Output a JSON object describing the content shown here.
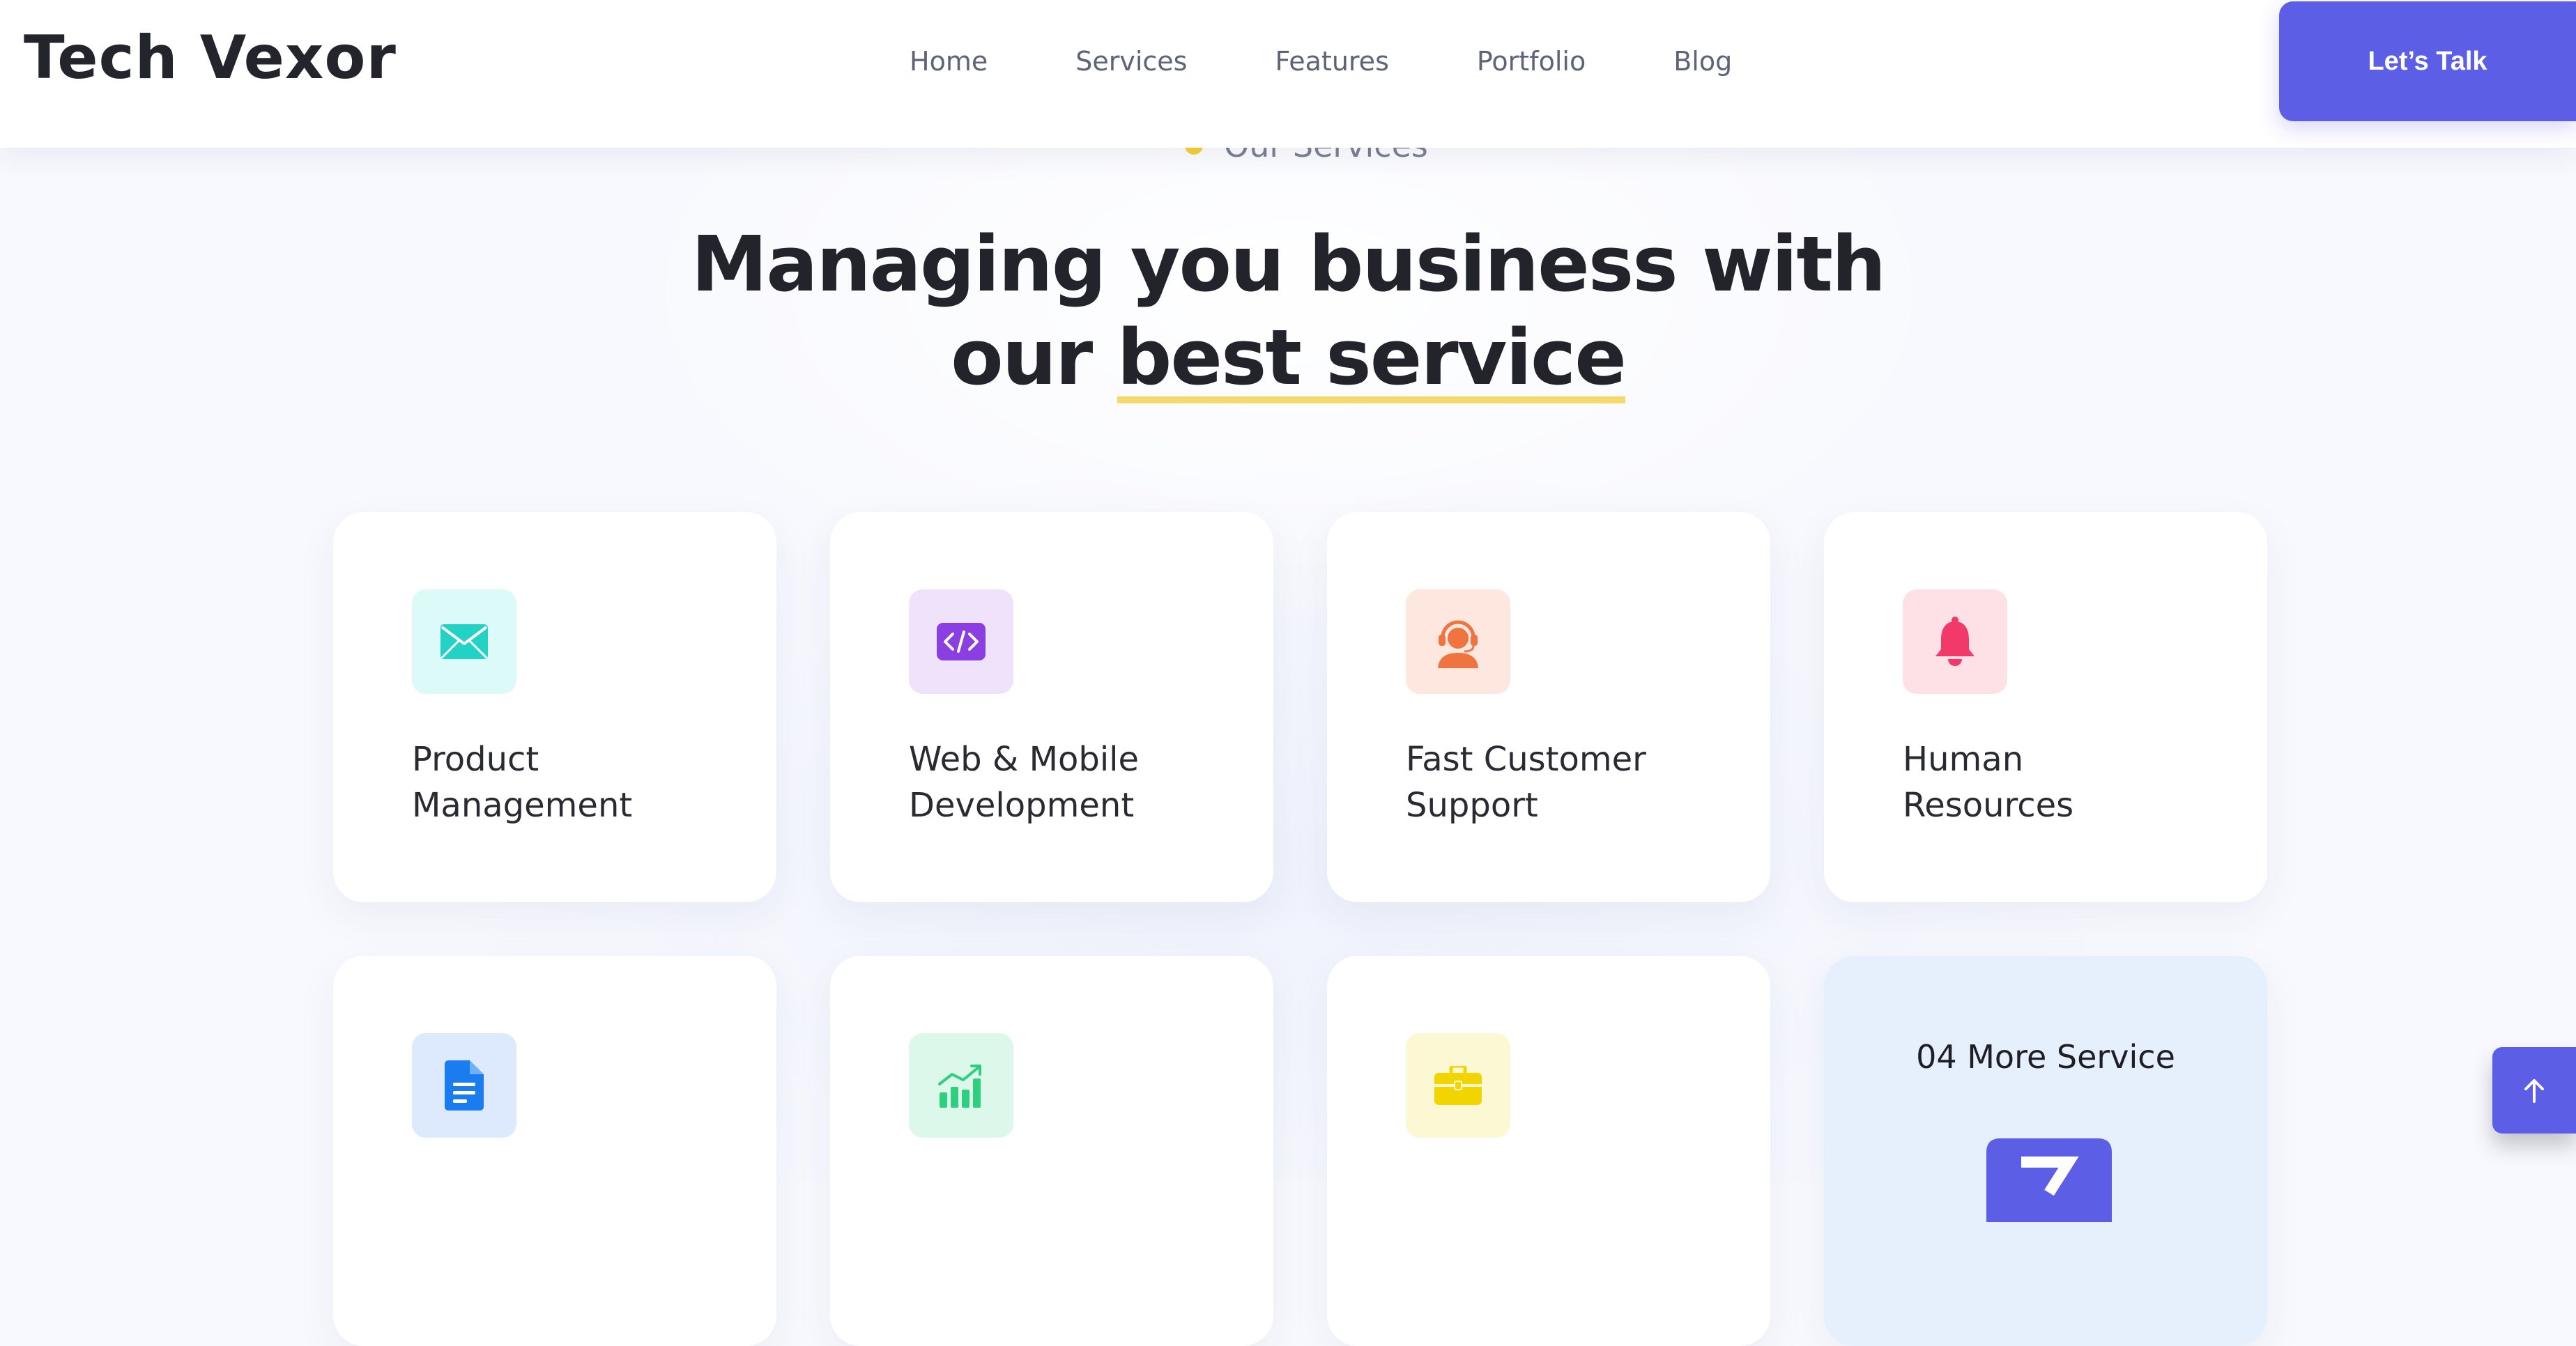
{
  "header": {
    "logo": "Tech Vexor",
    "nav": [
      "Home",
      "Services",
      "Features",
      "Portfolio",
      "Blog"
    ],
    "cta_label": "Let’s Talk",
    "accent_color": "#5c5fe6"
  },
  "section": {
    "label": "Our Services",
    "heading_line1": "Managing you business with",
    "heading_line2_prefix": "our ",
    "heading_line2_highlight": "best service"
  },
  "services": [
    {
      "title": "Product\nManagement",
      "icon": "envelope-icon",
      "icon_color": "#22d3c5",
      "icon_bg": "#dcfbf8"
    },
    {
      "title": "Web & Mobile\nDevelopment",
      "icon": "code-icon",
      "icon_color": "#8b3fe0",
      "icon_bg": "#efe2fb"
    },
    {
      "title": "Fast Customer\nSupport",
      "icon": "customer-support-icon",
      "icon_color": "#f0743f",
      "icon_bg": "#fde7df"
    },
    {
      "title": "Human\nResources",
      "icon": "bell-icon",
      "icon_color": "#f23a6a",
      "icon_bg": "#fde1e7"
    },
    {
      "title": "",
      "icon": "document-icon",
      "icon_color": "#1b7cf0",
      "icon_bg": "#dde9fd"
    },
    {
      "title": "",
      "icon": "bar-chart-icon",
      "icon_color": "#2fcf7f",
      "icon_bg": "#dcf8ea"
    },
    {
      "title": "",
      "icon": "briefcase-icon",
      "icon_color": "#f2d400",
      "icon_bg": "#fdf8d4"
    }
  ],
  "more_card": {
    "text": "04 More Service",
    "icon": "arrow-icon",
    "bg": "#e6f0fd"
  },
  "scroll_top": {
    "icon": "arrow-up-icon"
  }
}
